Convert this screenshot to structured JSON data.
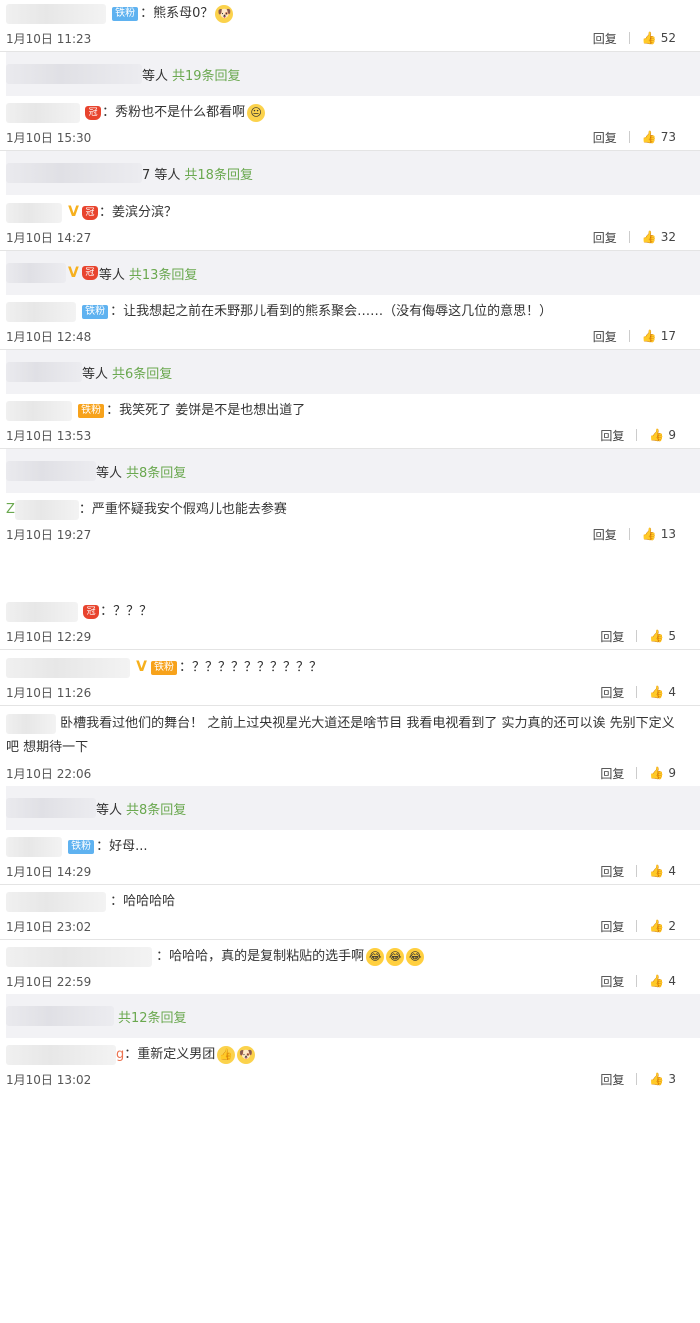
{
  "panel1": [
    {
      "user_tail": "",
      "badges": [
        "fan"
      ],
      "text": "：熊系母0？",
      "emoji": [
        "doge"
      ],
      "date": "1月10日 11:23",
      "reply": "回复",
      "likes": "52",
      "more": {
        "who": "等人",
        "count": "共19条回复"
      }
    },
    {
      "user_tail": "",
      "badges": [
        "crown"
      ],
      "text": "：秀粉也不是什么都看啊",
      "emoji": [
        "face"
      ],
      "date": "1月10日 15:30",
      "reply": "回复",
      "likes": "73",
      "more": {
        "who": "7 等人",
        "count": "共18条回复"
      }
    },
    {
      "user_tail": "",
      "badges": [
        "v",
        "crown"
      ],
      "text": "：姜滨分滨？",
      "emoji": [],
      "date": "1月10日 14:27",
      "reply": "回复",
      "likes": "32",
      "more": {
        "who": "等人",
        "count": "共13条回复",
        "badges": [
          "v",
          "crown"
        ]
      }
    },
    {
      "user_tail": "",
      "badges": [
        "fan"
      ],
      "text": "：让我想起之前在禾野那儿看到的熊系聚会……（没有侮辱这几位的意思！）",
      "emoji": [],
      "date": "1月10日 12:48",
      "reply": "回复",
      "likes": "17",
      "more": {
        "who": "等人",
        "count": "共6条回复"
      }
    },
    {
      "user_tail": "",
      "badges": [
        "fangold"
      ],
      "text": "：我笑死了 姜饼是不是也想出道了",
      "emoji": [],
      "date": "1月10日 13:53",
      "reply": "回复",
      "likes": "9",
      "more": {
        "who": "等人",
        "count": "共8条回复"
      }
    },
    {
      "user_tail": "Z",
      "badges": [],
      "text": "：严重怀疑我安个假鸡儿也能去参赛",
      "emoji": [],
      "date": "1月10日 19:27",
      "reply": "回复",
      "likes": "13"
    }
  ],
  "panel2": [
    {
      "badges": [
        "crown"
      ],
      "text": "：？？？",
      "emoji": [],
      "date": "1月10日 12:29",
      "reply": "回复",
      "likes": "5"
    },
    {
      "badges": [
        "v",
        "fangold"
      ],
      "text": "：？？？？？？？？？？",
      "emoji": [],
      "date": "1月10日 11:26",
      "reply": "回复",
      "likes": "4"
    },
    {
      "badges": [],
      "text": "卧槽我看过他们的舞台！ 之前上过央视星光大道还是啥节目 我看电视看到了 实力真的还可以诶 先别下定义吧 想期待一下",
      "emoji": [],
      "date": "1月10日 22:06",
      "reply": "回复",
      "likes": "9",
      "more": {
        "who": "等人",
        "count": "共8条回复"
      }
    },
    {
      "badges": [
        "fan"
      ],
      "text": "：好母...",
      "emoji": [],
      "date": "1月10日 14:29",
      "reply": "回复",
      "likes": "4"
    },
    {
      "badges": [],
      "text": "：哈哈哈哈",
      "emoji": [],
      "date": "1月10日 23:02",
      "reply": "回复",
      "likes": "2"
    },
    {
      "badges": [],
      "text": "：哈哈哈，真的是复制粘贴的选手啊",
      "emoji": [
        "laugh",
        "laugh",
        "laugh"
      ],
      "date": "1月10日 22:59",
      "reply": "回复",
      "likes": "4",
      "more": {
        "who": "",
        "count": "共12条回复"
      }
    },
    {
      "user_tail": "g",
      "badges": [],
      "text": "：重新定义男团",
      "emoji": [
        "thumb",
        "doge"
      ],
      "date": "1月10日 13:02",
      "reply": "回复",
      "likes": "3"
    }
  ],
  "labels": {
    "fan": "铁粉",
    "fangold": "铁粉",
    "v": "V",
    "crown": "冠"
  }
}
